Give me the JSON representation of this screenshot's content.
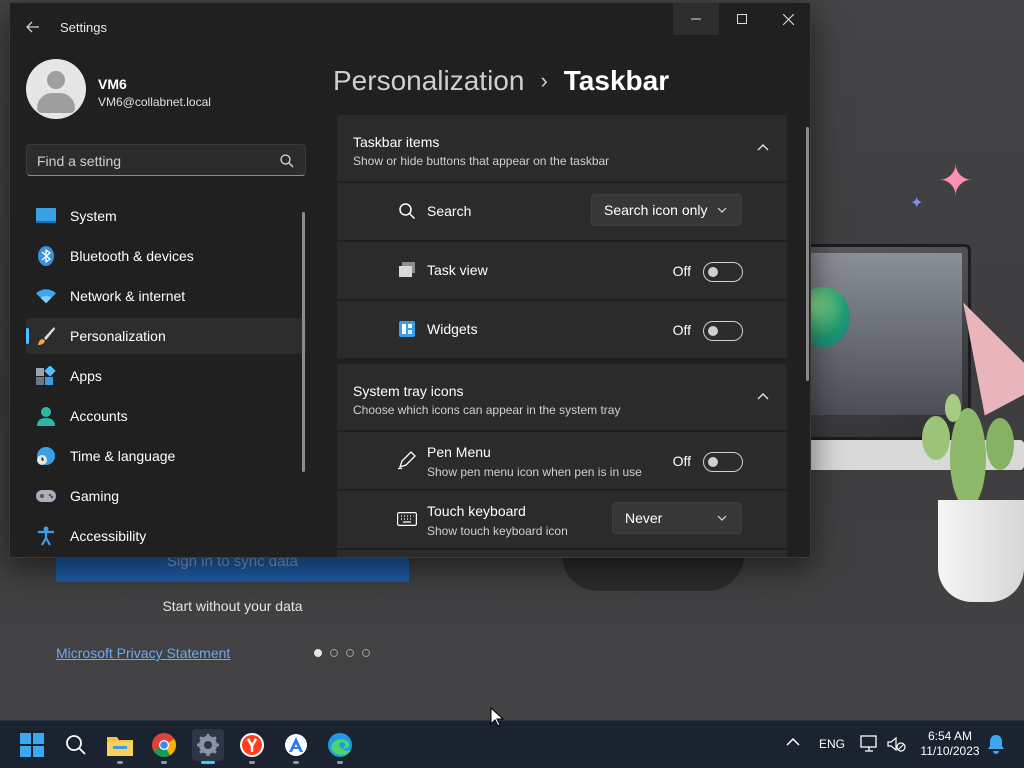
{
  "window": {
    "title": "Settings",
    "controls": {
      "minimize": "minimize",
      "maximize": "maximize",
      "close": "close"
    }
  },
  "user": {
    "name": "VM6",
    "email": "VM6@collabnet.local"
  },
  "search": {
    "placeholder": "Find a setting"
  },
  "nav": {
    "items": [
      {
        "label": "System",
        "icon": "system-icon"
      },
      {
        "label": "Bluetooth & devices",
        "icon": "bluetooth-icon"
      },
      {
        "label": "Network & internet",
        "icon": "wifi-icon"
      },
      {
        "label": "Personalization",
        "icon": "brush-icon",
        "selected": true
      },
      {
        "label": "Apps",
        "icon": "apps-icon"
      },
      {
        "label": "Accounts",
        "icon": "accounts-icon"
      },
      {
        "label": "Time & language",
        "icon": "globe-clock-icon"
      },
      {
        "label": "Gaming",
        "icon": "gamepad-icon"
      },
      {
        "label": "Accessibility",
        "icon": "accessibility-icon"
      }
    ]
  },
  "breadcrumb": {
    "parent": "Personalization",
    "separator": "›",
    "current": "Taskbar"
  },
  "sections": {
    "taskbar_items": {
      "title": "Taskbar items",
      "subtitle": "Show or hide buttons that appear on the taskbar",
      "rows": {
        "search": {
          "label": "Search",
          "value": "Search icon only"
        },
        "task_view": {
          "label": "Task view",
          "state": "Off"
        },
        "widgets": {
          "label": "Widgets",
          "state": "Off"
        }
      }
    },
    "system_tray": {
      "title": "System tray icons",
      "subtitle": "Choose which icons can appear in the system tray",
      "rows": {
        "pen_menu": {
          "label": "Pen Menu",
          "sub": "Show pen menu icon when pen is in use",
          "state": "Off"
        },
        "touch_keyboard": {
          "label": "Touch keyboard",
          "sub": "Show touch keyboard icon",
          "value": "Never"
        }
      }
    }
  },
  "background_page": {
    "sign_in": "Sign in to sync data",
    "start_without": "Start without your data",
    "privacy": "Microsoft Privacy Statement"
  },
  "taskbar": {
    "apps": [
      "start-icon",
      "search-icon",
      "file-explorer-icon",
      "chrome-icon",
      "settings-icon",
      "yandex-browser-icon",
      "app-installer-icon",
      "edge-icon"
    ],
    "tray": {
      "language": "ENG",
      "time": "6:54 AM",
      "date": "11/10/2023"
    }
  },
  "colors": {
    "accent": "#4cc2ff",
    "window_bg": "#202020",
    "card_bg": "#2b2b2b",
    "taskbar_bg": "#1b2230"
  }
}
